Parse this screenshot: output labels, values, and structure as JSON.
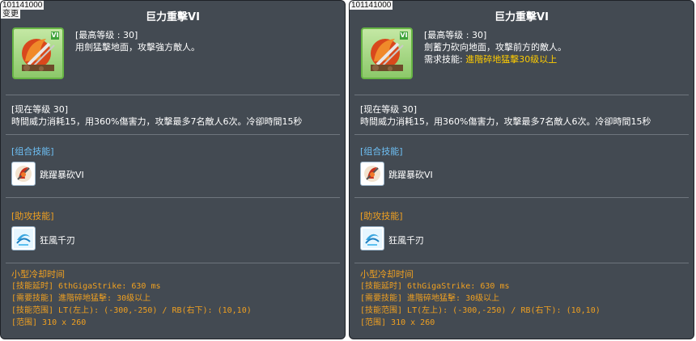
{
  "panels": [
    {
      "id_label": "101141000",
      "variant_label": "变更",
      "title": "巨力重擊VI",
      "corner_mark": "VI",
      "desc_lines": [
        "[最高等级 : 30]",
        "用劍猛擊地面，攻擊強方敵人。"
      ],
      "req_line": null,
      "level_header": "[现在等级 30]",
      "level_effect": "時間威力消耗15，用360%傷害力，攻擊最多7名敵人6次。冷卻時間15秒",
      "combo_header": "[组合技能]",
      "combo_skill": "跳躍暴砍VI",
      "assist_header": "[助攻技能]",
      "assist_skill": "狂風千刃",
      "cool_title": "小型冷却时间",
      "cool_lines": [
        "[技能延时] 6thGigaStrike: 630 ms",
        "[需要技能] 進階碎地猛擊: 30级以上",
        "[技能范围] LT(左上): (-300,-250) / RB(右下): (10,10)",
        "[范围] 310 x 260"
      ]
    },
    {
      "id_label": "101141000",
      "variant_label": null,
      "title": "巨力重擊VI",
      "corner_mark": "VI",
      "desc_lines": [
        "[最高等级 : 30]",
        "劍蓄力砍向地面，攻擊前方的敵人。"
      ],
      "req_line": {
        "label": "需求技能: ",
        "value": "進階碎地猛擊30级以上"
      },
      "level_header": "[现在等级 30]",
      "level_effect": "時間威力消耗15，用360%傷害力，攻擊最多7名敵人6次。冷卻時間15秒",
      "combo_header": "[组合技能]",
      "combo_skill": "跳躍暴砍VI",
      "assist_header": "[助攻技能]",
      "assist_skill": "狂風千刃",
      "cool_title": "小型冷却时间",
      "cool_lines": [
        "[技能延时] 6thGigaStrike: 630 ms",
        "[需要技能] 進階碎地猛擊: 30级以上",
        "[技能范围] LT(左上): (-300,-250) / RB(右下): (10,10)",
        "[范围] 310 x 260"
      ]
    }
  ],
  "colors": {
    "panel_bg": "#434a52",
    "text": "#ffffff",
    "combo_header": "#6ec0f5",
    "assist_header": "#f0a020",
    "requirement": "#ffcc00",
    "icon_frame": "#67b544"
  },
  "icons": {
    "main_skill": "giga-strike-icon",
    "combo_skill": "leap-slash-icon",
    "assist_skill": "whirlwind-blade-icon"
  }
}
